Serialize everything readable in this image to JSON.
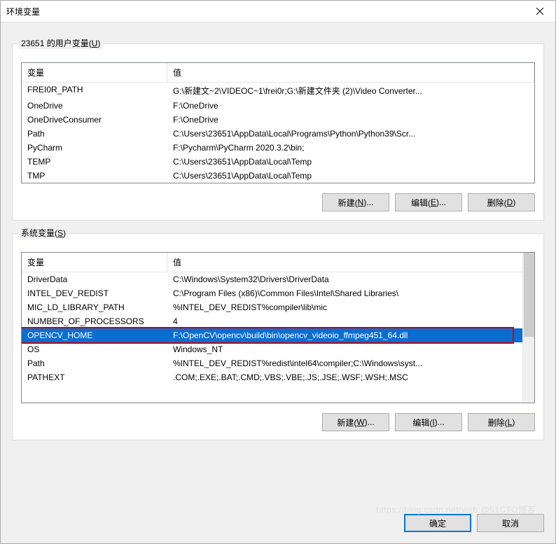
{
  "window": {
    "title": "环境变量"
  },
  "userVars": {
    "label_prefix": "23651 的用户变量(",
    "label_underline": "U",
    "label_suffix": ")",
    "header_var": "变量",
    "header_val": "值",
    "rows": [
      {
        "var": "FREI0R_PATH",
        "val": "G:\\新建文~2\\VIDEOC~1\\frei0r;G:\\新建文件夹 (2)\\Video Converter..."
      },
      {
        "var": "OneDrive",
        "val": "F:\\OneDrive"
      },
      {
        "var": "OneDriveConsumer",
        "val": "F:\\OneDrive"
      },
      {
        "var": "Path",
        "val": "C:\\Users\\23651\\AppData\\Local\\Programs\\Python\\Python39\\Scr..."
      },
      {
        "var": "PyCharm",
        "val": "F:\\Pycharm\\PyCharm 2020.3.2\\bin;"
      },
      {
        "var": "TEMP",
        "val": "C:\\Users\\23651\\AppData\\Local\\Temp"
      },
      {
        "var": "TMP",
        "val": "C:\\Users\\23651\\AppData\\Local\\Temp"
      }
    ],
    "btn_new_pre": "新建(",
    "btn_new_u": "N",
    "btn_new_suf": ")...",
    "btn_edit_pre": "编辑(",
    "btn_edit_u": "E",
    "btn_edit_suf": ")...",
    "btn_del_pre": "删除(",
    "btn_del_u": "D",
    "btn_del_suf": ")"
  },
  "sysVars": {
    "label_prefix": "系统变量(",
    "label_underline": "S",
    "label_suffix": ")",
    "header_var": "变量",
    "header_val": "值",
    "rows": [
      {
        "var": "DriverData",
        "val": "C:\\Windows\\System32\\Drivers\\DriverData"
      },
      {
        "var": "INTEL_DEV_REDIST",
        "val": "C:\\Program Files (x86)\\Common Files\\Intel\\Shared Libraries\\"
      },
      {
        "var": "MIC_LD_LIBRARY_PATH",
        "val": "%INTEL_DEV_REDIST%compiler\\lib\\mic"
      },
      {
        "var": "NUMBER_OF_PROCESSORS",
        "val": "4"
      },
      {
        "var": "OPENCV_HOME",
        "val": "F:\\OpenCV\\opencv\\build\\bin\\opencv_videoio_ffmpeg451_64.dll",
        "selected": true
      },
      {
        "var": "OS",
        "val": "Windows_NT"
      },
      {
        "var": "Path",
        "val": "%INTEL_DEV_REDIST%redist\\intel64\\compiler;C:\\Windows\\syst..."
      },
      {
        "var": "PATHEXT",
        "val": ".COM;.EXE;.BAT;.CMD;.VBS;.VBE;.JS;.JSE;.WSF;.WSH;.MSC"
      }
    ],
    "btn_new_pre": "新建(",
    "btn_new_u": "W",
    "btn_new_suf": ")...",
    "btn_edit_pre": "编辑(",
    "btn_edit_u": "I",
    "btn_edit_suf": ")...",
    "btn_del_pre": "删除(",
    "btn_del_u": "L",
    "btn_del_suf": ")"
  },
  "dialog": {
    "ok": "确定",
    "cancel": "取消"
  },
  "watermark": "https://blog.csdn.net/web @51CTO博客"
}
